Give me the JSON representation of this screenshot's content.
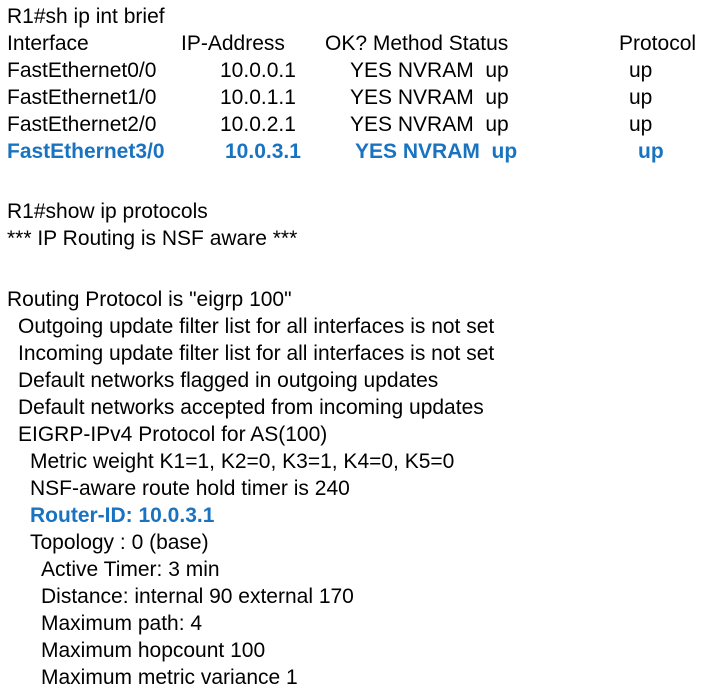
{
  "colors": {
    "text": "#000000",
    "highlight": "#1a73c1",
    "background": "#ffffff"
  },
  "prompt1": "R1#sh ip int brief",
  "table": {
    "headers": {
      "interface": "Interface",
      "ip": "IP-Address",
      "ok": "OK? Method Status",
      "protocol": "Protocol"
    },
    "rows": [
      {
        "interface": "FastEthernet0/0",
        "ip": "10.0.0.1",
        "ok_method_status": "YES NVRAM  up",
        "protocol": "up",
        "highlight": false
      },
      {
        "interface": "FastEthernet1/0",
        "ip": "10.0.1.1",
        "ok_method_status": "YES NVRAM  up",
        "protocol": "up",
        "highlight": false
      },
      {
        "interface": "FastEthernet2/0",
        "ip": "10.0.2.1",
        "ok_method_status": "YES NVRAM  up",
        "protocol": "up",
        "highlight": false
      },
      {
        "interface": "FastEthernet3/0",
        "ip": "10.0.3.1",
        "ok_method_status": "YES NVRAM  up",
        "protocol": "up",
        "highlight": true
      }
    ]
  },
  "prompt2": "R1#show ip protocols",
  "nsf_line": "*** IP Routing is NSF aware ***",
  "protocols": {
    "routing_protocol": "Routing Protocol is \"eigrp 100\"",
    "outgoing_filter": "Outgoing update filter list for all interfaces is not set",
    "incoming_filter": "Incoming update filter list for all interfaces is not set",
    "default_outgoing": "Default networks flagged in outgoing updates",
    "default_incoming": "Default networks accepted from incoming updates",
    "eigrp_as": "EIGRP-IPv4 Protocol for AS(100)",
    "metric_weight": "Metric weight K1=1, K2=0, K3=1, K4=0, K5=0",
    "nsf_hold_timer": "NSF-aware route hold timer is 240",
    "router_id": "Router-ID: 10.0.3.1",
    "topology": "Topology : 0 (base)",
    "active_timer": "Active Timer: 3 min",
    "distance": "Distance: internal 90 external 170",
    "max_path": "Maximum path: 4",
    "max_hopcount": "Maximum hopcount 100",
    "max_variance": "Maximum metric variance 1"
  }
}
